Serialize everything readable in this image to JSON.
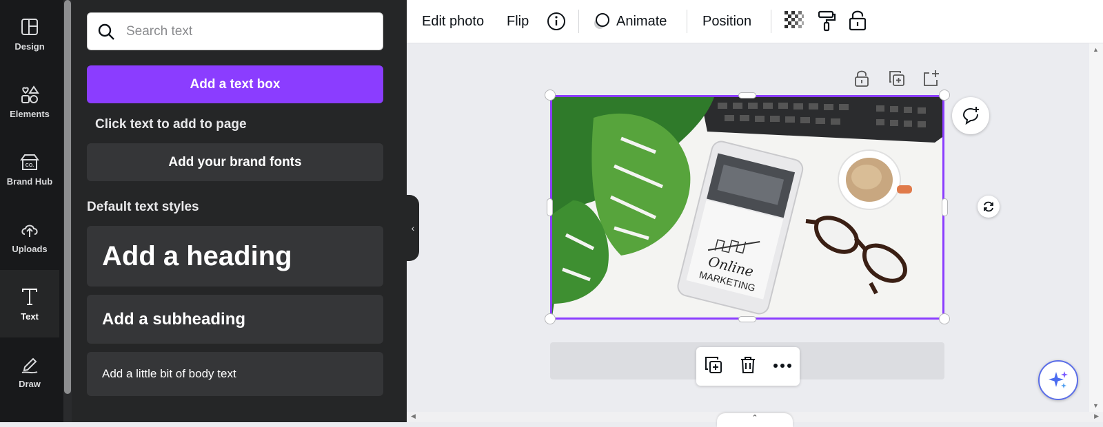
{
  "rail": {
    "items": [
      {
        "label": "Design",
        "icon": "layout-icon"
      },
      {
        "label": "Elements",
        "icon": "shapes-icon"
      },
      {
        "label": "Brand Hub",
        "icon": "brand-hub-icon"
      },
      {
        "label": "Uploads",
        "icon": "cloud-upload-icon"
      },
      {
        "label": "Text",
        "icon": "text-icon",
        "active": true
      },
      {
        "label": "Draw",
        "icon": "draw-pen-icon"
      }
    ]
  },
  "panel": {
    "search_placeholder": "Search text",
    "add_text_box": "Add a text box",
    "click_hint": "Click text to add to page",
    "brand_fonts": "Add your brand fonts",
    "default_styles": "Default text styles",
    "heading": "Add a heading",
    "subheading": "Add a subheading",
    "body": "Add a little bit of body text"
  },
  "toolbar": {
    "edit_photo": "Edit photo",
    "flip": "Flip",
    "animate": "Animate",
    "position": "Position"
  },
  "photo_text": {
    "line1": "Online",
    "line2": "MARKETING"
  },
  "colors": {
    "accent": "#8b3dff",
    "panel_bg": "#252627",
    "rail_bg": "#18191b",
    "canvas_bg": "#ebecf0"
  }
}
